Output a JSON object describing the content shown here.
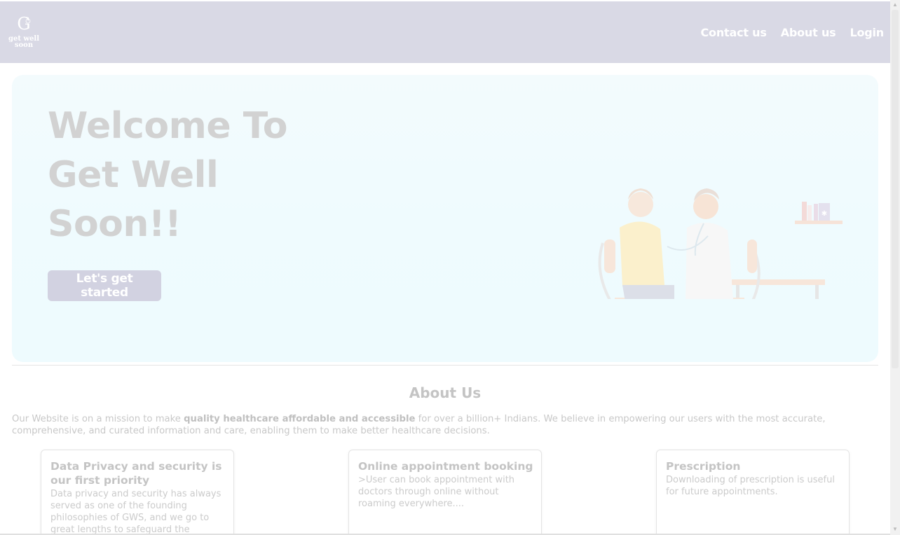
{
  "brand": {
    "logo_letter": "G",
    "logo_line1": "get well",
    "logo_line2": "soon"
  },
  "nav": {
    "links": [
      "Contact us",
      "About us",
      "Login"
    ]
  },
  "hero": {
    "title_line1": "Welcome To",
    "title_line2": "Get Well",
    "title_line3": "Soon!!",
    "cta_label": "Let's get started"
  },
  "about": {
    "heading": "About Us",
    "text_before": "Our Website is on a mission to make ",
    "text_bold": "quality healthcare affordable and accessible",
    "text_after": " for over a billion+ Indians. We believe in empowering our users with the most accurate, comprehensive, and curated information and care, enabling them to make better healthcare decisions."
  },
  "cards": [
    {
      "title": "Data Privacy and security is our first priority",
      "text": "Data privacy and security has always served as one of the founding philosophies of GWS, and we go to great lengths to safeguard the"
    },
    {
      "title": "Online appointment booking",
      "text": ">User can book appointment with doctors through online without roaming everywhere...."
    },
    {
      "title": "Prescription",
      "text": "Downloading of prescription is useful for future appointments."
    }
  ],
  "colors": {
    "navbar": "#d9d9e5",
    "hero_bg": "#eefbfe",
    "button": "#d2d2e1"
  }
}
